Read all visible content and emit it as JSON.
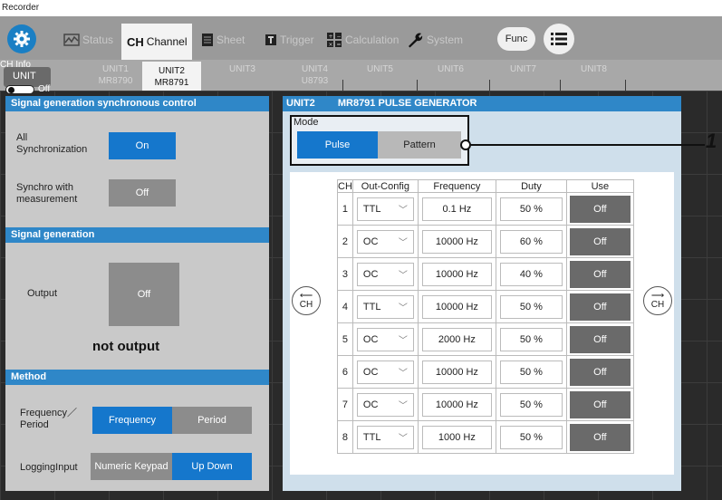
{
  "window_title": "Recorder",
  "toolbar": {
    "tabs": [
      {
        "label": "Status",
        "icon": "status-icon"
      },
      {
        "label": "Channel",
        "prefix": "CH",
        "active": true
      },
      {
        "label": "Sheet",
        "icon": "sheet-icon"
      },
      {
        "label": "Trigger",
        "icon": "trigger-icon"
      },
      {
        "label": "Calculation",
        "icon": "calculation-icon"
      },
      {
        "label": "System",
        "icon": "wrench-icon"
      }
    ],
    "func_label": "Func"
  },
  "unit_bar": {
    "ch_info": "CH Info",
    "unit_label": "UNIT",
    "toggle_label": "Off",
    "tabs": [
      {
        "name": "UNIT1",
        "model": "MR8790"
      },
      {
        "name": "UNIT2",
        "model": "MR8791",
        "active": true
      },
      {
        "name": "UNIT3",
        "model": ""
      },
      {
        "name": "UNIT4",
        "model": "U8793"
      },
      {
        "name": "UNIT5",
        "model": ""
      },
      {
        "name": "UNIT6",
        "model": ""
      },
      {
        "name": "UNIT7",
        "model": ""
      },
      {
        "name": "UNIT8",
        "model": ""
      }
    ]
  },
  "left": {
    "sync_header": "Signal generation synchronous control",
    "all_sync_label": "All Synchronization",
    "all_sync_value": "On",
    "synchro_meas_label": "Synchro with measurement",
    "synchro_meas_value": "Off",
    "signal_header": "Signal generation",
    "output_label": "Output",
    "output_value": "Off",
    "status_text": "not output",
    "method_header": "Method",
    "freq_period_label": "Frequency／Period",
    "freq_option": "Frequency",
    "period_option": "Period",
    "logging_label": "LoggingInput",
    "numeric_option": "Numeric Keypad",
    "updown_option": "Up Down"
  },
  "right": {
    "header_unit": "UNIT2",
    "header_model": "MR8791 PULSE GENERATOR",
    "mode_label": "Mode",
    "mode_pulse": "Pulse",
    "mode_pattern": "Pattern",
    "callout": "1",
    "nav_prev": "CH",
    "nav_next": "CH",
    "columns": [
      "CH",
      "Out-Config",
      "Frequency",
      "Duty",
      "Use"
    ],
    "rows": [
      {
        "ch": "1",
        "cfg": "TTL",
        "freq": "0.1 Hz",
        "duty": "50 %",
        "use": "Off"
      },
      {
        "ch": "2",
        "cfg": "OC",
        "freq": "10000 Hz",
        "duty": "60 %",
        "use": "Off"
      },
      {
        "ch": "3",
        "cfg": "OC",
        "freq": "10000 Hz",
        "duty": "40 %",
        "use": "Off"
      },
      {
        "ch": "4",
        "cfg": "TTL",
        "freq": "10000 Hz",
        "duty": "50 %",
        "use": "Off"
      },
      {
        "ch": "5",
        "cfg": "OC",
        "freq": "2000 Hz",
        "duty": "50 %",
        "use": "Off"
      },
      {
        "ch": "6",
        "cfg": "OC",
        "freq": "10000 Hz",
        "duty": "50 %",
        "use": "Off"
      },
      {
        "ch": "7",
        "cfg": "OC",
        "freq": "10000 Hz",
        "duty": "50 %",
        "use": "Off"
      },
      {
        "ch": "8",
        "cfg": "TTL",
        "freq": "1000 Hz",
        "duty": "50 %",
        "use": "Off"
      }
    ]
  },
  "colors": {
    "accent": "#1577cc",
    "header": "#2f87c8",
    "panel": "#c9c9c9"
  }
}
